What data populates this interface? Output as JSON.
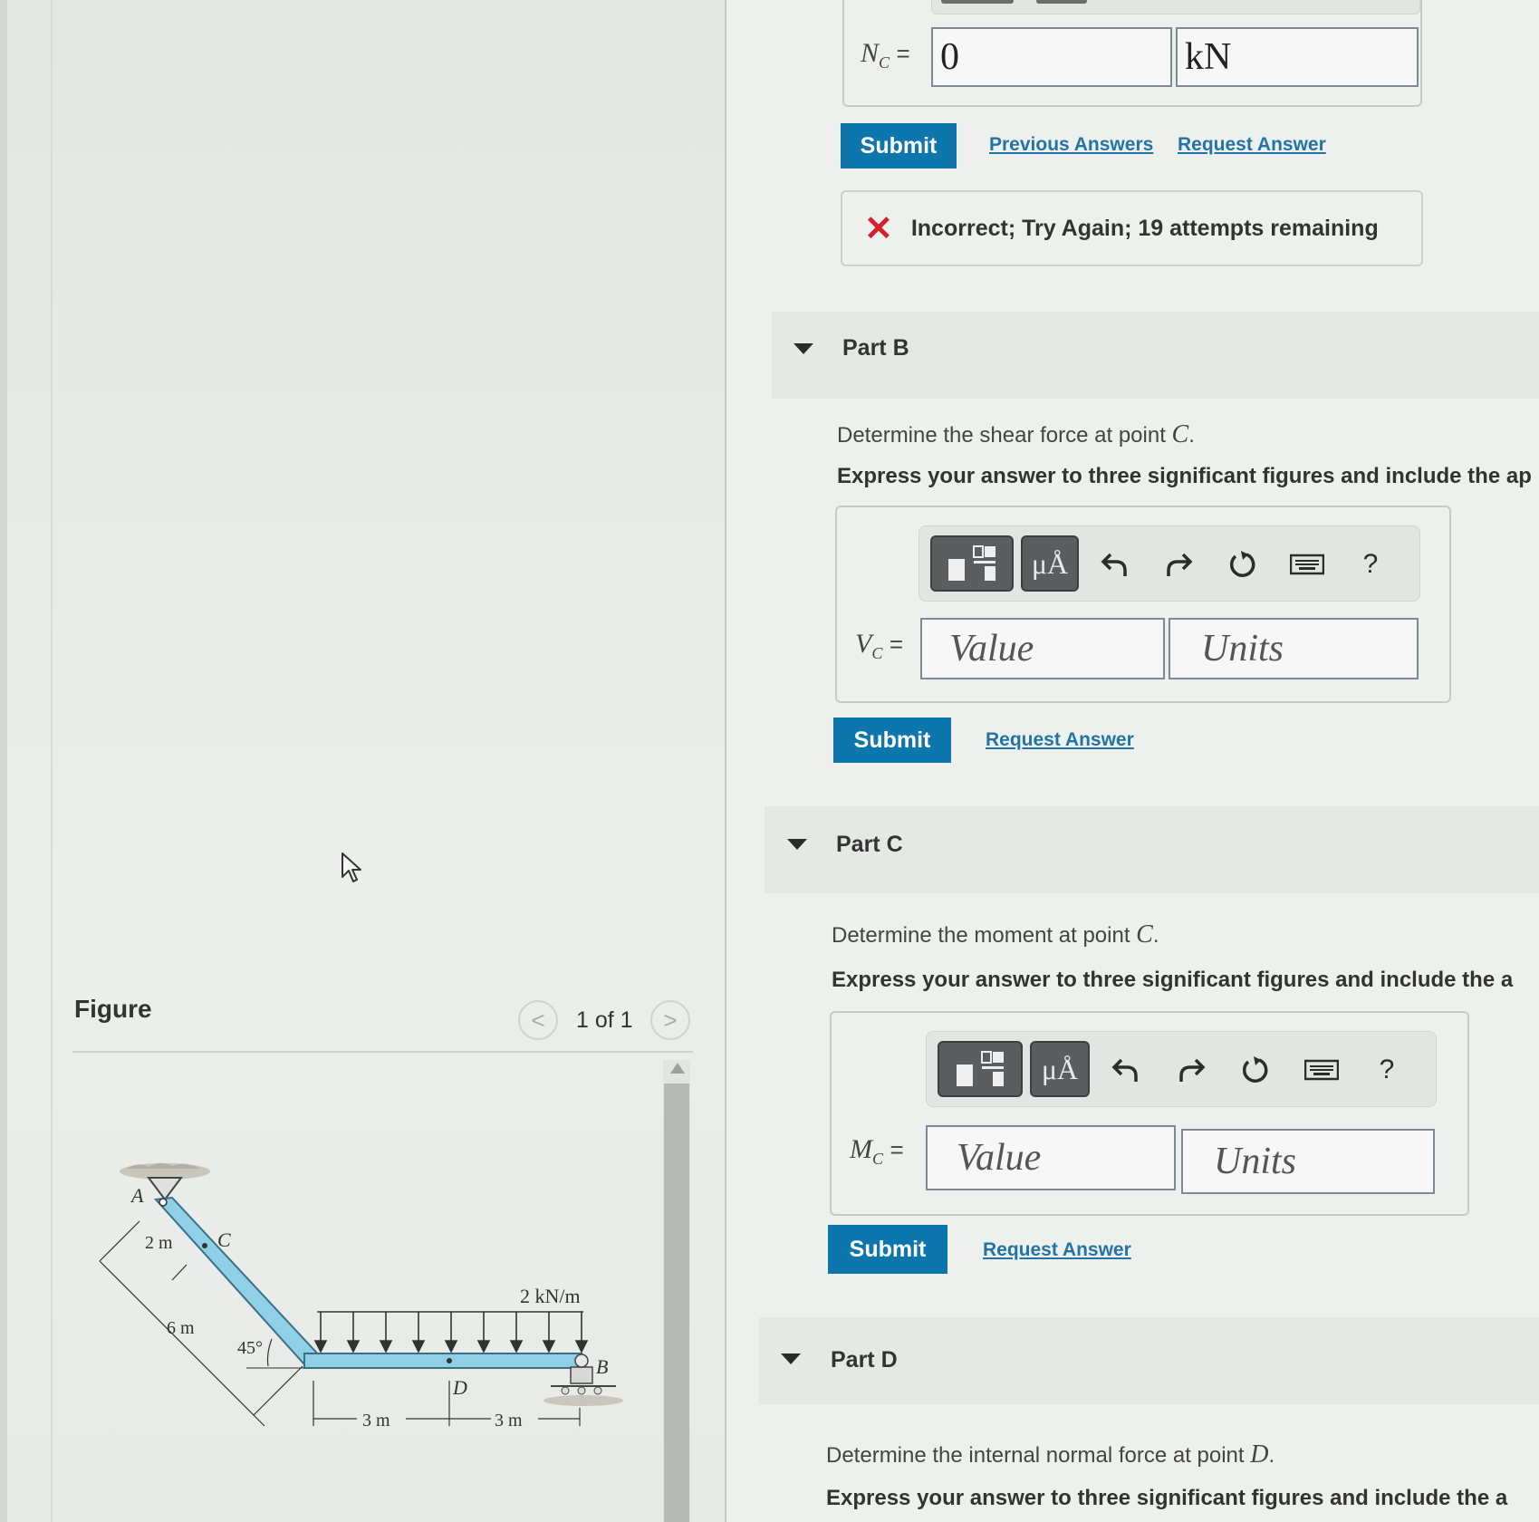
{
  "partA": {
    "label": "N",
    "label_sub": "C",
    "equals": "=",
    "value": "0",
    "units": "kN",
    "submit": "Submit",
    "previous_answers": "Previous Answers",
    "request_answer": "Request Answer",
    "feedback": "Incorrect; Try Again; 19 attempts remaining"
  },
  "partB": {
    "title": "Part B",
    "prompt_text": "Determine the shear force at point ",
    "prompt_symbol": "C",
    "prompt_end": ".",
    "instruction": "Express your answer to three significant figures and include the ap",
    "label": "V",
    "label_sub": "C",
    "equals": "=",
    "value_placeholder": "Value",
    "units_placeholder": "Units",
    "submit": "Submit",
    "request_answer": "Request Answer"
  },
  "partC": {
    "title": "Part C",
    "prompt_text": "Determine the moment at point ",
    "prompt_symbol": "C",
    "prompt_end": ".",
    "instruction": "Express your answer to three significant figures and include the a",
    "label": "M",
    "label_sub": "C",
    "equals": "=",
    "value_placeholder": "Value",
    "units_placeholder": "Units",
    "submit": "Submit",
    "request_answer": "Request Answer"
  },
  "partD": {
    "title": "Part D",
    "prompt_text": "Determine the internal normal force at point ",
    "prompt_symbol": "D",
    "prompt_end": ".",
    "instruction": "Express your answer to three significant figures and include the a"
  },
  "toolbar": {
    "units_button": "μÅ",
    "help": "?",
    "icons": [
      "templates-icon",
      "units-icon",
      "undo-icon",
      "redo-icon",
      "reset-icon",
      "keyboard-icon",
      "help-icon"
    ]
  },
  "figure": {
    "title": "Figure",
    "counter": "1 of 1",
    "prev": "<",
    "next": ">",
    "labels": {
      "A": "A",
      "B": "B",
      "C": "C",
      "D": "D",
      "dim_2m": "2 m",
      "dim_6m": "6 m",
      "angle": "45°",
      "load": "2 kN/m",
      "dim_3m_left": "3 m",
      "dim_3m_right": "3 m"
    }
  },
  "colors": {
    "submit_bg": "#0d76ad",
    "link": "#2274a5",
    "error_x": "#d3202a",
    "beam": "#8fd0e6"
  }
}
